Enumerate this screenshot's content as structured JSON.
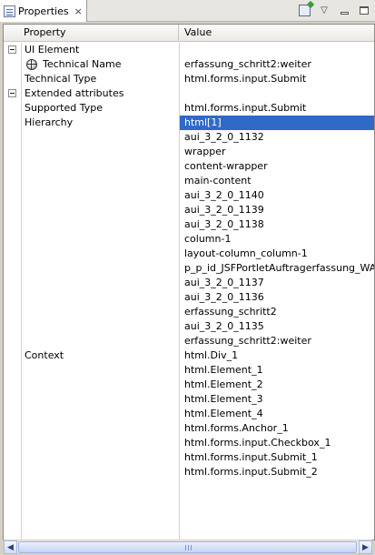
{
  "view": {
    "tab_label": "Properties",
    "tab_close": "×"
  },
  "toolbar": {
    "pin_icon": "pin-to-view-icon",
    "menu_glyph": "▽",
    "min_icon": "minimize-icon",
    "max_icon": "maximize-icon"
  },
  "table": {
    "columns": [
      "Property",
      "Value"
    ],
    "rows": [
      {
        "kind": "category",
        "label": "UI Element",
        "value": ""
      },
      {
        "kind": "child-icon",
        "label": "Technical Name",
        "value": "erfassung_schritt2:weiter",
        "icon": "globe-icon"
      },
      {
        "kind": "child",
        "label": "Technical Type",
        "value": "html.forms.input.Submit"
      },
      {
        "kind": "category",
        "label": "Extended attributes",
        "value": ""
      },
      {
        "kind": "child",
        "label": "Supported Type",
        "value": "html.forms.input.Submit"
      },
      {
        "kind": "child",
        "label": "Hierarchy",
        "value": "html[1]",
        "selected": true
      },
      {
        "kind": "child",
        "label": "",
        "value": "aui_3_2_0_1132"
      },
      {
        "kind": "child",
        "label": "",
        "value": "wrapper"
      },
      {
        "kind": "child",
        "label": "",
        "value": "content-wrapper"
      },
      {
        "kind": "child",
        "label": "",
        "value": "main-content"
      },
      {
        "kind": "child",
        "label": "",
        "value": "aui_3_2_0_1140"
      },
      {
        "kind": "child",
        "label": "",
        "value": "aui_3_2_0_1139"
      },
      {
        "kind": "child",
        "label": "",
        "value": "aui_3_2_0_1138"
      },
      {
        "kind": "child",
        "label": "",
        "value": "column-1"
      },
      {
        "kind": "child",
        "label": "",
        "value": "layout-column_column-1"
      },
      {
        "kind": "child",
        "label": "",
        "value": "p_p_id_JSFPortletAuftragerfassung_WAR_..."
      },
      {
        "kind": "child",
        "label": "",
        "value": "aui_3_2_0_1137"
      },
      {
        "kind": "child",
        "label": "",
        "value": "aui_3_2_0_1136"
      },
      {
        "kind": "child",
        "label": "",
        "value": "erfassung_schritt2"
      },
      {
        "kind": "child",
        "label": "",
        "value": "aui_3_2_0_1135"
      },
      {
        "kind": "child",
        "label": "",
        "value": "erfassung_schritt2:weiter"
      },
      {
        "kind": "child",
        "label": "Context",
        "value": "html.Div_1"
      },
      {
        "kind": "child",
        "label": "",
        "value": "html.Element_1"
      },
      {
        "kind": "child",
        "label": "",
        "value": "html.Element_2"
      },
      {
        "kind": "child",
        "label": "",
        "value": "html.Element_3"
      },
      {
        "kind": "child",
        "label": "",
        "value": "html.Element_4"
      },
      {
        "kind": "child",
        "label": "",
        "value": "html.forms.Anchor_1"
      },
      {
        "kind": "child",
        "label": "",
        "value": "html.forms.input.Checkbox_1"
      },
      {
        "kind": "child",
        "label": "",
        "value": "html.forms.input.Submit_1"
      },
      {
        "kind": "child",
        "label": "",
        "value": "html.forms.input.Submit_2"
      }
    ]
  },
  "scrollbar": {
    "left_glyph": "◀",
    "right_glyph": "▶"
  }
}
